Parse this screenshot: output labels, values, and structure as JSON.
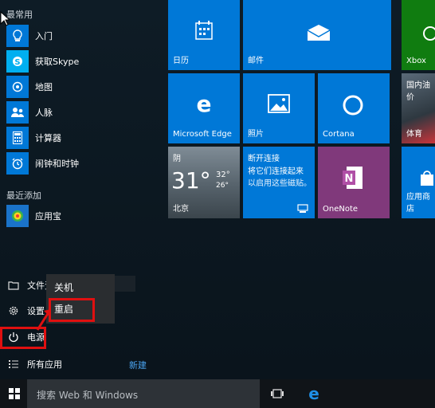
{
  "start_menu": {
    "most_used_heading": "最常用",
    "recently_added_heading": "最近添加",
    "most_used": [
      {
        "label": "入门",
        "icon": "lightbulb-icon"
      },
      {
        "label": "获取Skype",
        "icon": "skype-icon"
      },
      {
        "label": "地图",
        "icon": "camera-icon"
      },
      {
        "label": "人脉",
        "icon": "people-icon"
      },
      {
        "label": "计算器",
        "icon": "calculator-icon"
      },
      {
        "label": "闹钟和时钟",
        "icon": "alarm-clock-icon"
      }
    ],
    "recently_added": [
      {
        "label": "应用宝",
        "icon": "yingyongbao-icon"
      }
    ],
    "bottom": {
      "file_explorer": "文件资",
      "settings": "设置",
      "power": "电源",
      "all_apps": "所有应用",
      "new_badge": "新建"
    },
    "power_menu": {
      "shutdown": "关机",
      "restart": "重启"
    }
  },
  "tiles": {
    "calendar": "日历",
    "mail": "邮件",
    "xbox": "Xbox",
    "edge": "Microsoft Edge",
    "photos": "照片",
    "cortana": "Cortana",
    "news_partial": "国内油价",
    "sports": "体育",
    "weather": {
      "condition": "阴",
      "temp": "31°",
      "high": "32°",
      "low": "26°",
      "city": "北京"
    },
    "connect": {
      "line1": "断开连接",
      "line2": "将它们连接起来",
      "line3": "以启用这些磁贴。"
    },
    "onenote": "OneNote",
    "store_partial": "应用商店"
  },
  "taskbar": {
    "search_placeholder": "搜索 Web 和 Windows"
  },
  "colors": {
    "tile_blue": "#0078d7",
    "xbox_green": "#107c10",
    "onenote_purple": "#80397b",
    "highlight_red": "#e01010"
  }
}
